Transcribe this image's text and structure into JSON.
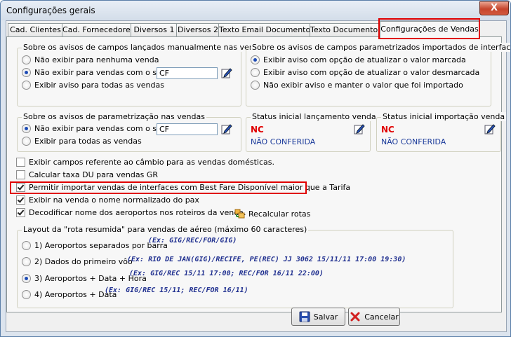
{
  "window": {
    "title": "Configurações gerais",
    "close_glyph": "X"
  },
  "tabs": [
    {
      "label": "Cad. Clientes"
    },
    {
      "label": "Cad. Fornecedores"
    },
    {
      "label": "Diversos 1"
    },
    {
      "label": "Diversos 2"
    },
    {
      "label": "Texto Email Documentos"
    },
    {
      "label": "Texto Documentos"
    },
    {
      "label": "Configurações de Vendas",
      "active": true
    }
  ],
  "group_manual": {
    "title": "Sobre os avisos de campos lançados manualmente nas vendas",
    "options": [
      {
        "label": "Não exibir para nenhuma venda",
        "selected": false
      },
      {
        "label": "Não exibir para vendas com o status",
        "selected": true
      },
      {
        "label": "Exibir aviso para todas as vendas",
        "selected": false
      }
    ],
    "status_value": "CF"
  },
  "group_interfaces": {
    "title": "Sobre os avisos de campos parametrizados importados de interfaces",
    "options": [
      {
        "label": "Exibir aviso com opção de atualizar o valor marcada",
        "selected": true
      },
      {
        "label": "Exibir aviso com opção de atualizar o valor desmarcada",
        "selected": false
      },
      {
        "label": "Não exibir aviso e manter o valor que foi importado",
        "selected": false
      }
    ]
  },
  "group_param": {
    "title": "Sobre os avisos de parametrização nas vendas",
    "options": [
      {
        "label": "Não exibir para vendas com o status",
        "selected": true
      },
      {
        "label": "Exibir para todas as vendas",
        "selected": false
      }
    ],
    "status_value": "CF"
  },
  "status_lancamento": {
    "title": "Status inicial lançamento venda",
    "code": "NC",
    "desc": "NÃO CONFERIDA"
  },
  "status_importacao": {
    "title": "Status inicial importação venda",
    "code": "NC",
    "desc": "NÃO CONFERIDA"
  },
  "checks": [
    {
      "label": "Exibir campos referente ao câmbio para as vendas domésticas.",
      "checked": false
    },
    {
      "label": "Calcular taxa DU para vendas GR",
      "checked": false
    },
    {
      "label": "Permitir importar vendas de interfaces com Best Fare Disponível maior que a Tarifa",
      "checked": true
    },
    {
      "label": "Exibir na venda o nome normalizado do pax",
      "checked": true
    },
    {
      "label": "Decodificar nome dos aeroportos nos roteiros da venda.",
      "checked": true
    }
  ],
  "recalc_label": "Recalcular rotas",
  "layout_group": {
    "title": "Layout da \"rota resumida\" para vendas de aéreo (máximo 60 caracteres)",
    "options": [
      {
        "label": "1) Aeroportos separados por barra",
        "example": "(Ex: GIG/REC/FOR/GIG)",
        "selected": false
      },
      {
        "label": "2) Dados do primeiro vôo",
        "example": "(Ex: RIO DE JAN(GIG)/RECIFE, PE(REC) JJ 3062 15/11/11 17:00 19:30)",
        "selected": false
      },
      {
        "label": "3) Aeroportos + Data + Hora",
        "example": "(Ex: GIG/REC 15/11 17:00; REC/FOR 16/11 22:00)",
        "selected": true
      },
      {
        "label": "4) Aeroportos + Data",
        "example": "(Ex: GIG/REC 15/11; REC/FOR 16/11)",
        "selected": false
      }
    ]
  },
  "buttons": {
    "save": "Salvar",
    "cancel": "Cancelar"
  },
  "colors": {
    "highlight": "#e00000",
    "status_code": "#e00000",
    "status_desc": "#1a3a9a"
  }
}
